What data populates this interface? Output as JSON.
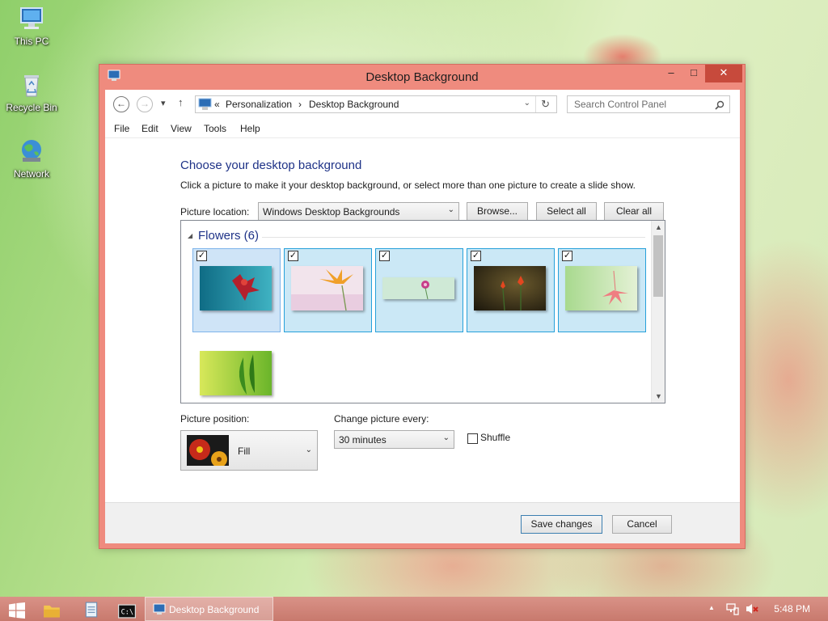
{
  "desktop": {
    "icons": [
      {
        "label": "This PC",
        "icon": "computer-icon"
      },
      {
        "label": "Recycle Bin",
        "icon": "recycle-bin-icon"
      },
      {
        "label": "Network",
        "icon": "network-globe-icon"
      }
    ]
  },
  "window": {
    "title": "Desktop Background",
    "controls": {
      "minimize": "–",
      "maximize": "□",
      "close": "✕"
    },
    "accent_color": "#ef8b7e"
  },
  "navbar": {
    "back": "←",
    "forward": "→",
    "recent_dropdown": "▾",
    "up": "↑",
    "breadcrumb": {
      "overflow": "«",
      "items": [
        "Personalization",
        "Desktop Background"
      ],
      "separator": "›"
    },
    "address_dropdown": "⌄",
    "refresh": "↻",
    "search_placeholder": "Search Control Panel"
  },
  "menubar": {
    "items": [
      "File",
      "Edit",
      "View",
      "Tools",
      "Help"
    ]
  },
  "content": {
    "heading": "Choose your desktop background",
    "description": "Click a picture to make it your desktop background, or select more than one picture to create a slide show.",
    "picture_location_label": "Picture location:",
    "picture_location_value": "Windows Desktop Backgrounds",
    "browse_label": "Browse...",
    "select_all_label": "Select all",
    "clear_all_label": "Clear all",
    "group": {
      "title": "Flowers (6)",
      "pictures": [
        {
          "name": "flowers-1",
          "checked": true
        },
        {
          "name": "flowers-2",
          "checked": true
        },
        {
          "name": "flowers-3",
          "checked": true
        },
        {
          "name": "flowers-4",
          "checked": true
        },
        {
          "name": "flowers-5",
          "checked": true
        },
        {
          "name": "flowers-6",
          "checked": false
        }
      ]
    },
    "picture_position_label": "Picture position:",
    "picture_position_value": "Fill",
    "change_every_label": "Change picture every:",
    "change_every_value": "30 minutes",
    "shuffle_label": "Shuffle",
    "shuffle_checked": false
  },
  "footer": {
    "save_label": "Save changes",
    "cancel_label": "Cancel"
  },
  "taskbar": {
    "window_label": "Desktop Background",
    "time": "5:48 PM",
    "tray_overflow": "▲"
  }
}
